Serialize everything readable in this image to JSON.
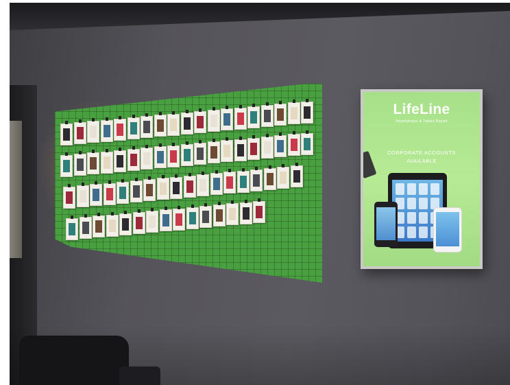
{
  "sign": {
    "brand": "LifeLine",
    "subtitle": "Smartphone & Tablet Repair",
    "promo_line_1": "CORPORATE ACCOUNTS",
    "promo_line_2": "AVAILABLE"
  },
  "colors": {
    "board_green": "#48a040",
    "sign_green": "#b0e58e",
    "wall_gray": "#5a5960"
  }
}
